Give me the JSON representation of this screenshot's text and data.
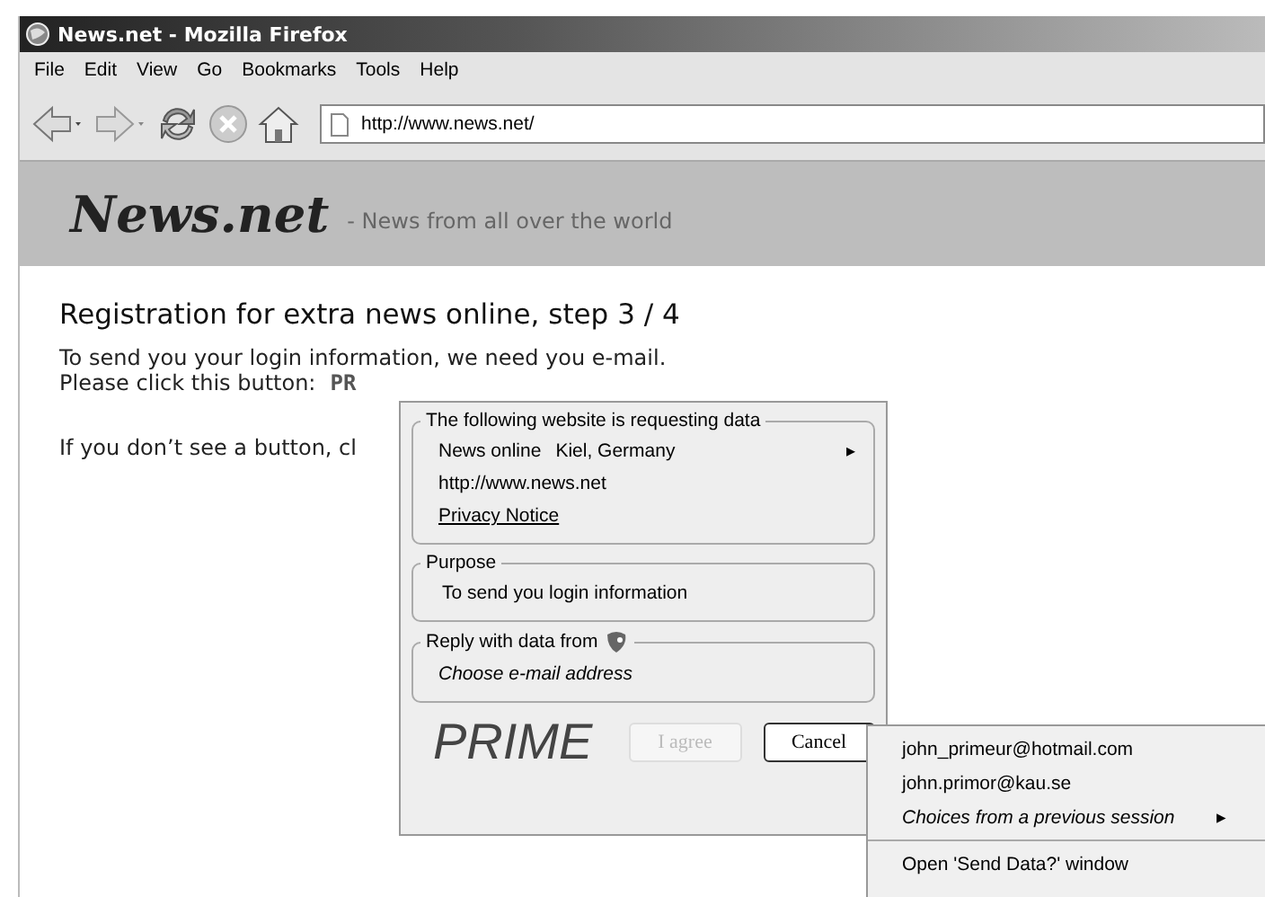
{
  "window": {
    "title": "News.net - Mozilla Firefox"
  },
  "menu": [
    {
      "label": "File"
    },
    {
      "label": "Edit"
    },
    {
      "label": "View"
    },
    {
      "label": "Go"
    },
    {
      "label": "Bookmarks"
    },
    {
      "label": "Tools"
    },
    {
      "label": "Help"
    }
  ],
  "address_bar": {
    "value": "http://www.news.net/"
  },
  "site": {
    "logo": "News.net",
    "tagline": "- News from all over the world"
  },
  "page": {
    "heading": "Registration for extra news online, step 3 / 4",
    "line_1": "To send you your login information, we need you e-mail.",
    "line_2": "Please click this button:",
    "button_text": "PR",
    "line_3": "If you don’t see a button, cl"
  },
  "dialog": {
    "sections": [
      {
        "kind": "website",
        "legend": "The following website is requesting data",
        "name": "News online",
        "location": "Kiel, Germany",
        "arrow": "▸",
        "url": "http://www.news.net",
        "link": "Privacy Notice"
      },
      {
        "kind": "purpose",
        "legend": "Purpose",
        "text": "To send you login information"
      },
      {
        "kind": "reply",
        "legend": "Reply with data from",
        "choice": "Choose e-mail address"
      }
    ],
    "logo": "PRIME",
    "buttons": [
      {
        "label": "I agree",
        "disabled": true
      },
      {
        "label": "Cancel",
        "disabled": false
      }
    ]
  },
  "submenu": {
    "items": [
      {
        "kind": "item",
        "label": "john_primeur@hotmail.com"
      },
      {
        "kind": "item",
        "label": "john.primor@kau.se"
      },
      {
        "kind": "submenu",
        "label": "Choices from a previous session",
        "arrow": "▸"
      },
      {
        "kind": "item",
        "label": "Open 'Send Data?' window"
      }
    ]
  }
}
